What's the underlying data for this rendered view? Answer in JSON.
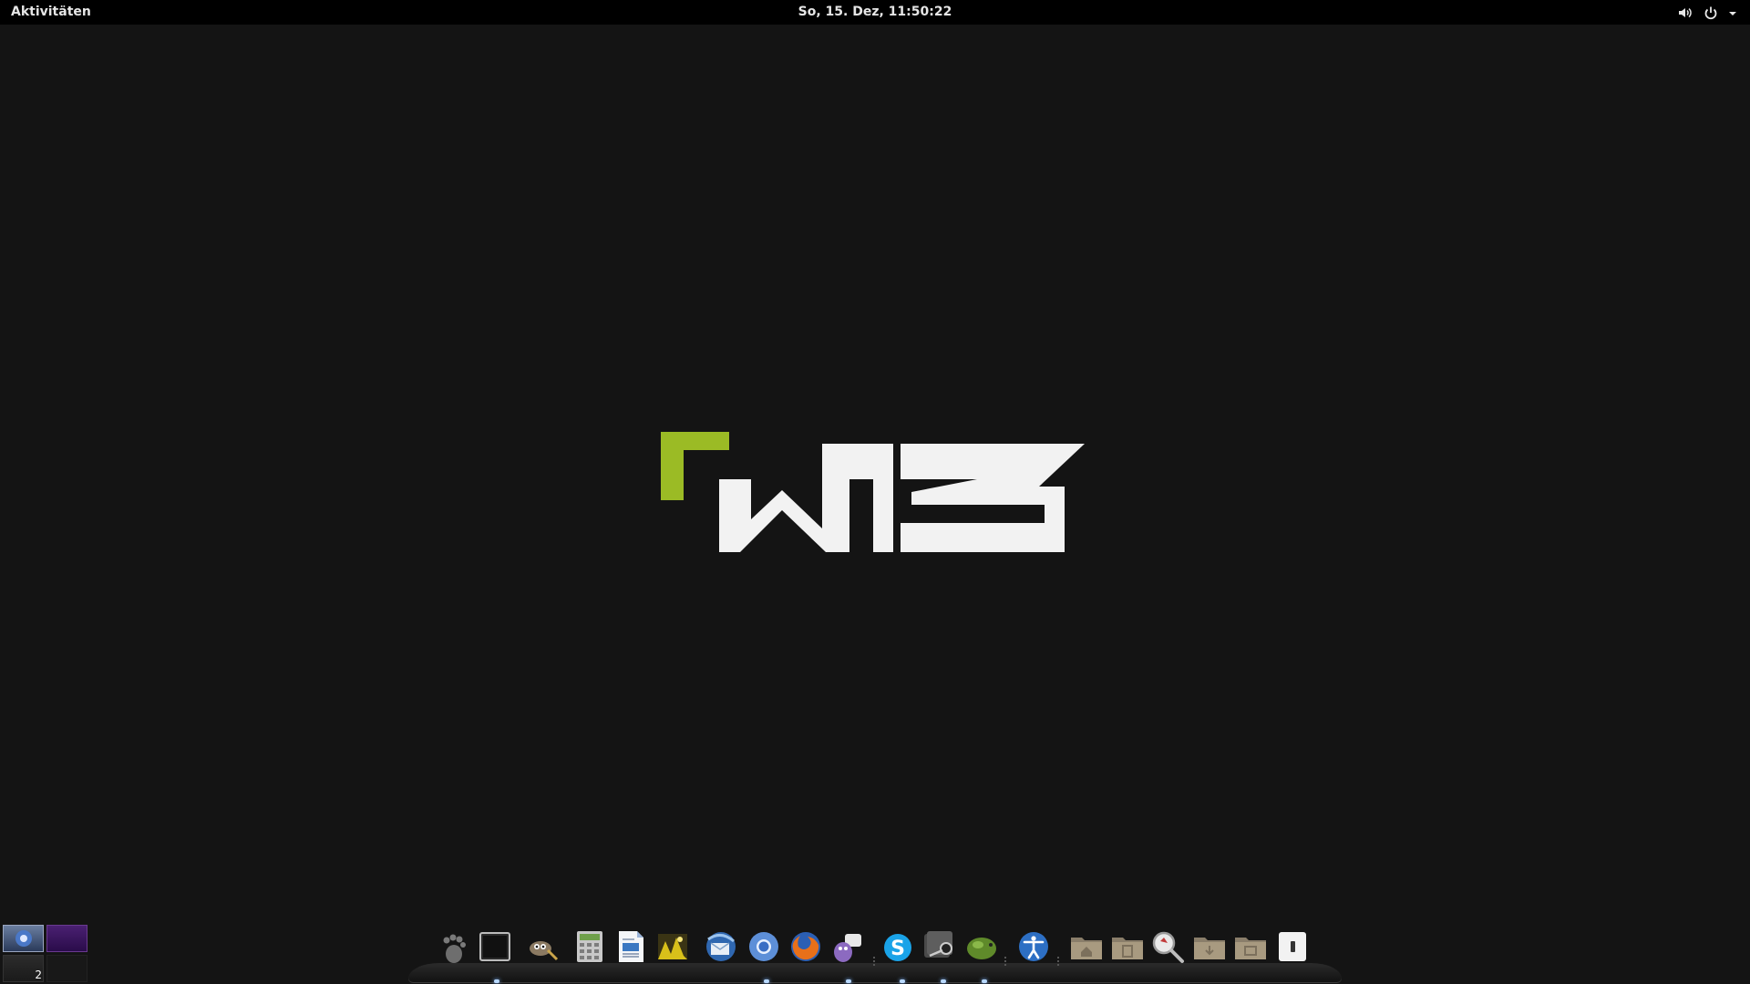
{
  "topbar": {
    "activities_label": "Aktivitäten",
    "clock": "So, 15. Dez, 11:50:22",
    "tray": {
      "volume_icon": "speaker-icon",
      "power_icon": "power-icon",
      "menu_icon": "chevron-down-icon"
    }
  },
  "workspaces": {
    "current_label": "2"
  },
  "dock": {
    "apps": [
      {
        "icon": "gnome-foot-icon"
      },
      {
        "icon": "terminal-icon"
      },
      {
        "icon": "gimp-icon"
      },
      {
        "icon": "calculator-icon"
      },
      {
        "icon": "text-editor-icon"
      },
      {
        "icon": "image-viewer-icon"
      },
      {
        "icon": "thunderbird-icon"
      },
      {
        "icon": "chromium-icon"
      },
      {
        "icon": "firefox-icon"
      },
      {
        "icon": "pidgin-icon"
      },
      {
        "icon": "skype-icon"
      },
      {
        "icon": "steam-icon"
      },
      {
        "icon": "cheese-icon"
      },
      {
        "icon": "accessibility-icon"
      }
    ],
    "places": [
      {
        "icon": "home-folder-icon"
      },
      {
        "icon": "documents-folder-icon"
      },
      {
        "icon": "search-icon"
      },
      {
        "icon": "downloads-folder-icon"
      },
      {
        "icon": "pictures-folder-icon"
      },
      {
        "icon": "removable-drive-icon"
      }
    ]
  },
  "colors": {
    "background": "#141414",
    "topbar": "#000000",
    "logo_accent": "#9bbb25",
    "logo_main": "#f2f2f2",
    "running_indicator": "#b8d8ff"
  }
}
